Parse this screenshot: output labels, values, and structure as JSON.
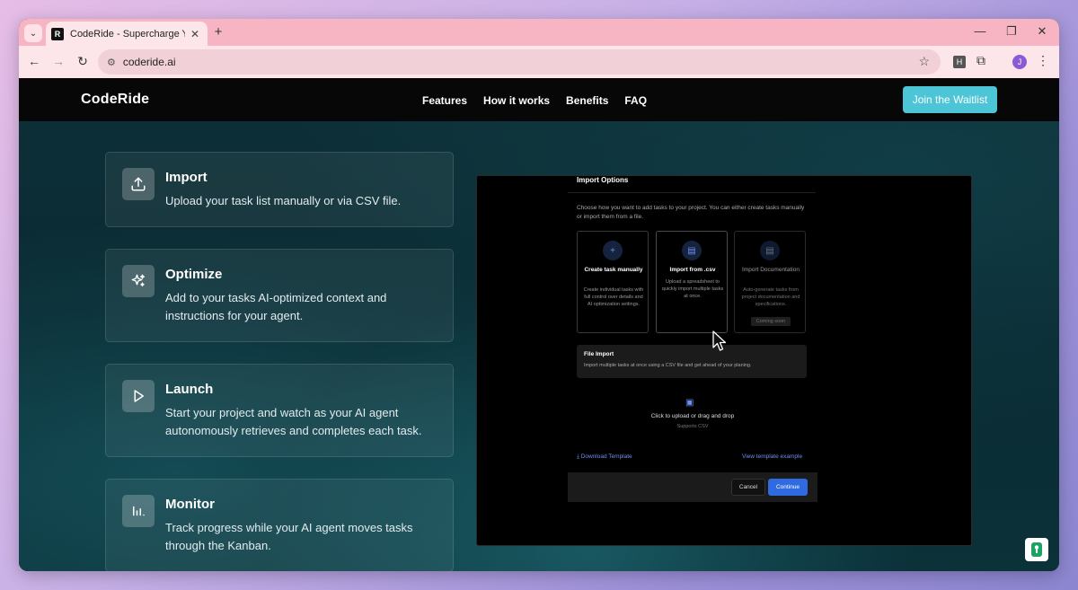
{
  "browser": {
    "tab": {
      "title": "CodeRide - Supercharge Your AI",
      "favicon_letter": "R"
    },
    "url": "coderide.ai",
    "extension_letter": "H",
    "profile_initial": "J"
  },
  "header": {
    "logo": "CodeRide",
    "nav": [
      "Features",
      "How it works",
      "Benefits",
      "FAQ"
    ],
    "cta": "Join the Waitlist"
  },
  "features": [
    {
      "title": "Import",
      "desc": "Upload your task list manually or via CSV file.",
      "icon": "upload-icon"
    },
    {
      "title": "Optimize",
      "desc": "Add to your tasks AI-optimized context and instructions for your agent.",
      "icon": "sparkles-icon"
    },
    {
      "title": "Launch",
      "desc": "Start your project and watch as your AI agent autonomously retrieves and completes each task.",
      "icon": "play-icon"
    },
    {
      "title": "Monitor",
      "desc": "Track progress while your AI agent moves tasks through the Kanban.",
      "icon": "bar-chart-icon"
    }
  ],
  "dialog": {
    "title": "Import Options",
    "desc": "Choose how you want to add tasks to your project. You can either create tasks manually or import them from a file.",
    "options": [
      {
        "title": "Create task manually",
        "desc": "Create individual tasks with full control over details and AI optimization settings."
      },
      {
        "title": "Import from .csv",
        "desc": "Upload a spreadsheet to quickly import multiple tasks at once."
      },
      {
        "title": "Import Documentation",
        "desc": "Auto-generate tasks from project documentation and specifications.",
        "badge": "Coming soon"
      }
    ],
    "file_import": {
      "title": "File Import",
      "desc": "Import multiple tasks at once using a CSV file and get ahead of your planing."
    },
    "upload": {
      "text": "Click to upload or drag and drop",
      "sub": "Supports CSV"
    },
    "download_template": "Download Template",
    "view_example": "View template example",
    "cancel": "Cancel",
    "continue": "Continue"
  }
}
